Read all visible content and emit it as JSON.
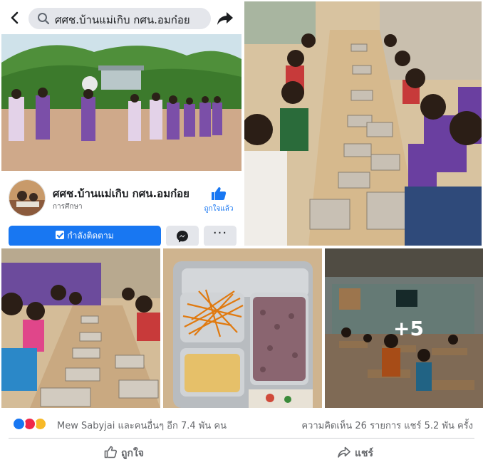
{
  "phone_card": {
    "search_query": "ศศช.บ้านแม่เกิบ กศน.อมก๋อย",
    "page_name": "ศศช.บ้านแม่เกิบ กศน.อมก๋อย",
    "page_category": "การศึกษา",
    "liked_label": "ถูกใจแล้ว",
    "following_label": "กำลังติดตาม",
    "more_label": "···"
  },
  "grid": {
    "more_photos_label": "+5"
  },
  "reactions": {
    "icons": [
      "like-icon",
      "love-icon",
      "haha-icon"
    ],
    "summary": "Mew Sabyjai และคนอื่นๆ อีก 7.4 พัน คน",
    "counts": "ความคิดเห็น 26 รายการ  แชร์ 5.2 พัน ครั้ง"
  },
  "actions": {
    "like_label": "ถูกใจ",
    "share_label": "แชร์"
  },
  "colors": {
    "facebook_blue": "#1877f2",
    "gray_text": "#65676b",
    "light_gray": "#e4e6eb"
  }
}
